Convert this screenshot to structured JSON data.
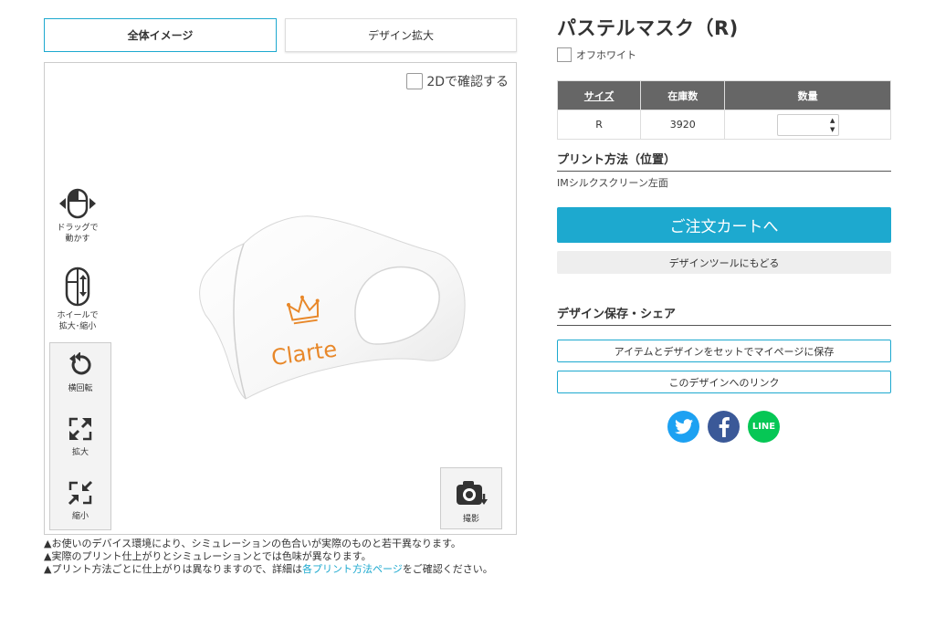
{
  "tabs": {
    "full_image": "全体イメージ",
    "design_zoom": "デザイン拡大"
  },
  "viewer": {
    "check_2d": "2Dで確認する",
    "drag_hint_1": "ドラッグで",
    "drag_hint_2": "動かす",
    "wheel_hint_1": "ホイールで",
    "wheel_hint_2": "拡大･縮小",
    "rotate_label": "横回転",
    "zoom_in_label": "拡大",
    "zoom_out_label": "縮小",
    "capture_label": "撮影",
    "logo_text": "Clarte",
    "logo_color": "#e8882a"
  },
  "notes": {
    "note1": "お使いのデバイス環境により、シミュレーションの色合いが実際のものと若干異なります。",
    "note2": "実際のプリント仕上がりとシミュレーションとでは色味が異なります。",
    "note3_a": "プリント方法ごとに仕上がりは異なりますので、詳細は",
    "note3_link": "各プリント方法ページ",
    "note3_b": "をご確認ください。"
  },
  "product": {
    "title": "パステルマスク（R)",
    "color_option": "オフホワイト"
  },
  "stock_table": {
    "headers": {
      "size": "サイズ",
      "stock": "在庫数",
      "quantity": "数量"
    },
    "row": {
      "size": "R",
      "stock": "3920",
      "quantity": ""
    }
  },
  "print": {
    "heading": "プリント方法（位置）",
    "value": "IMシルクスクリーン左面"
  },
  "buttons": {
    "cart": "ご注文カートへ",
    "back_to_tool": "デザインツールにもどる",
    "save_mypage": "アイテムとデザインをセットでマイページに保存",
    "design_link": "このデザインへのリンク"
  },
  "share": {
    "heading": "デザイン保存・シェア",
    "line_label": "LINE"
  },
  "colors": {
    "accent": "#1da9cf",
    "twitter": "#1da1f2",
    "facebook": "#3b5998",
    "line": "#06c755",
    "table_header": "#666666"
  }
}
